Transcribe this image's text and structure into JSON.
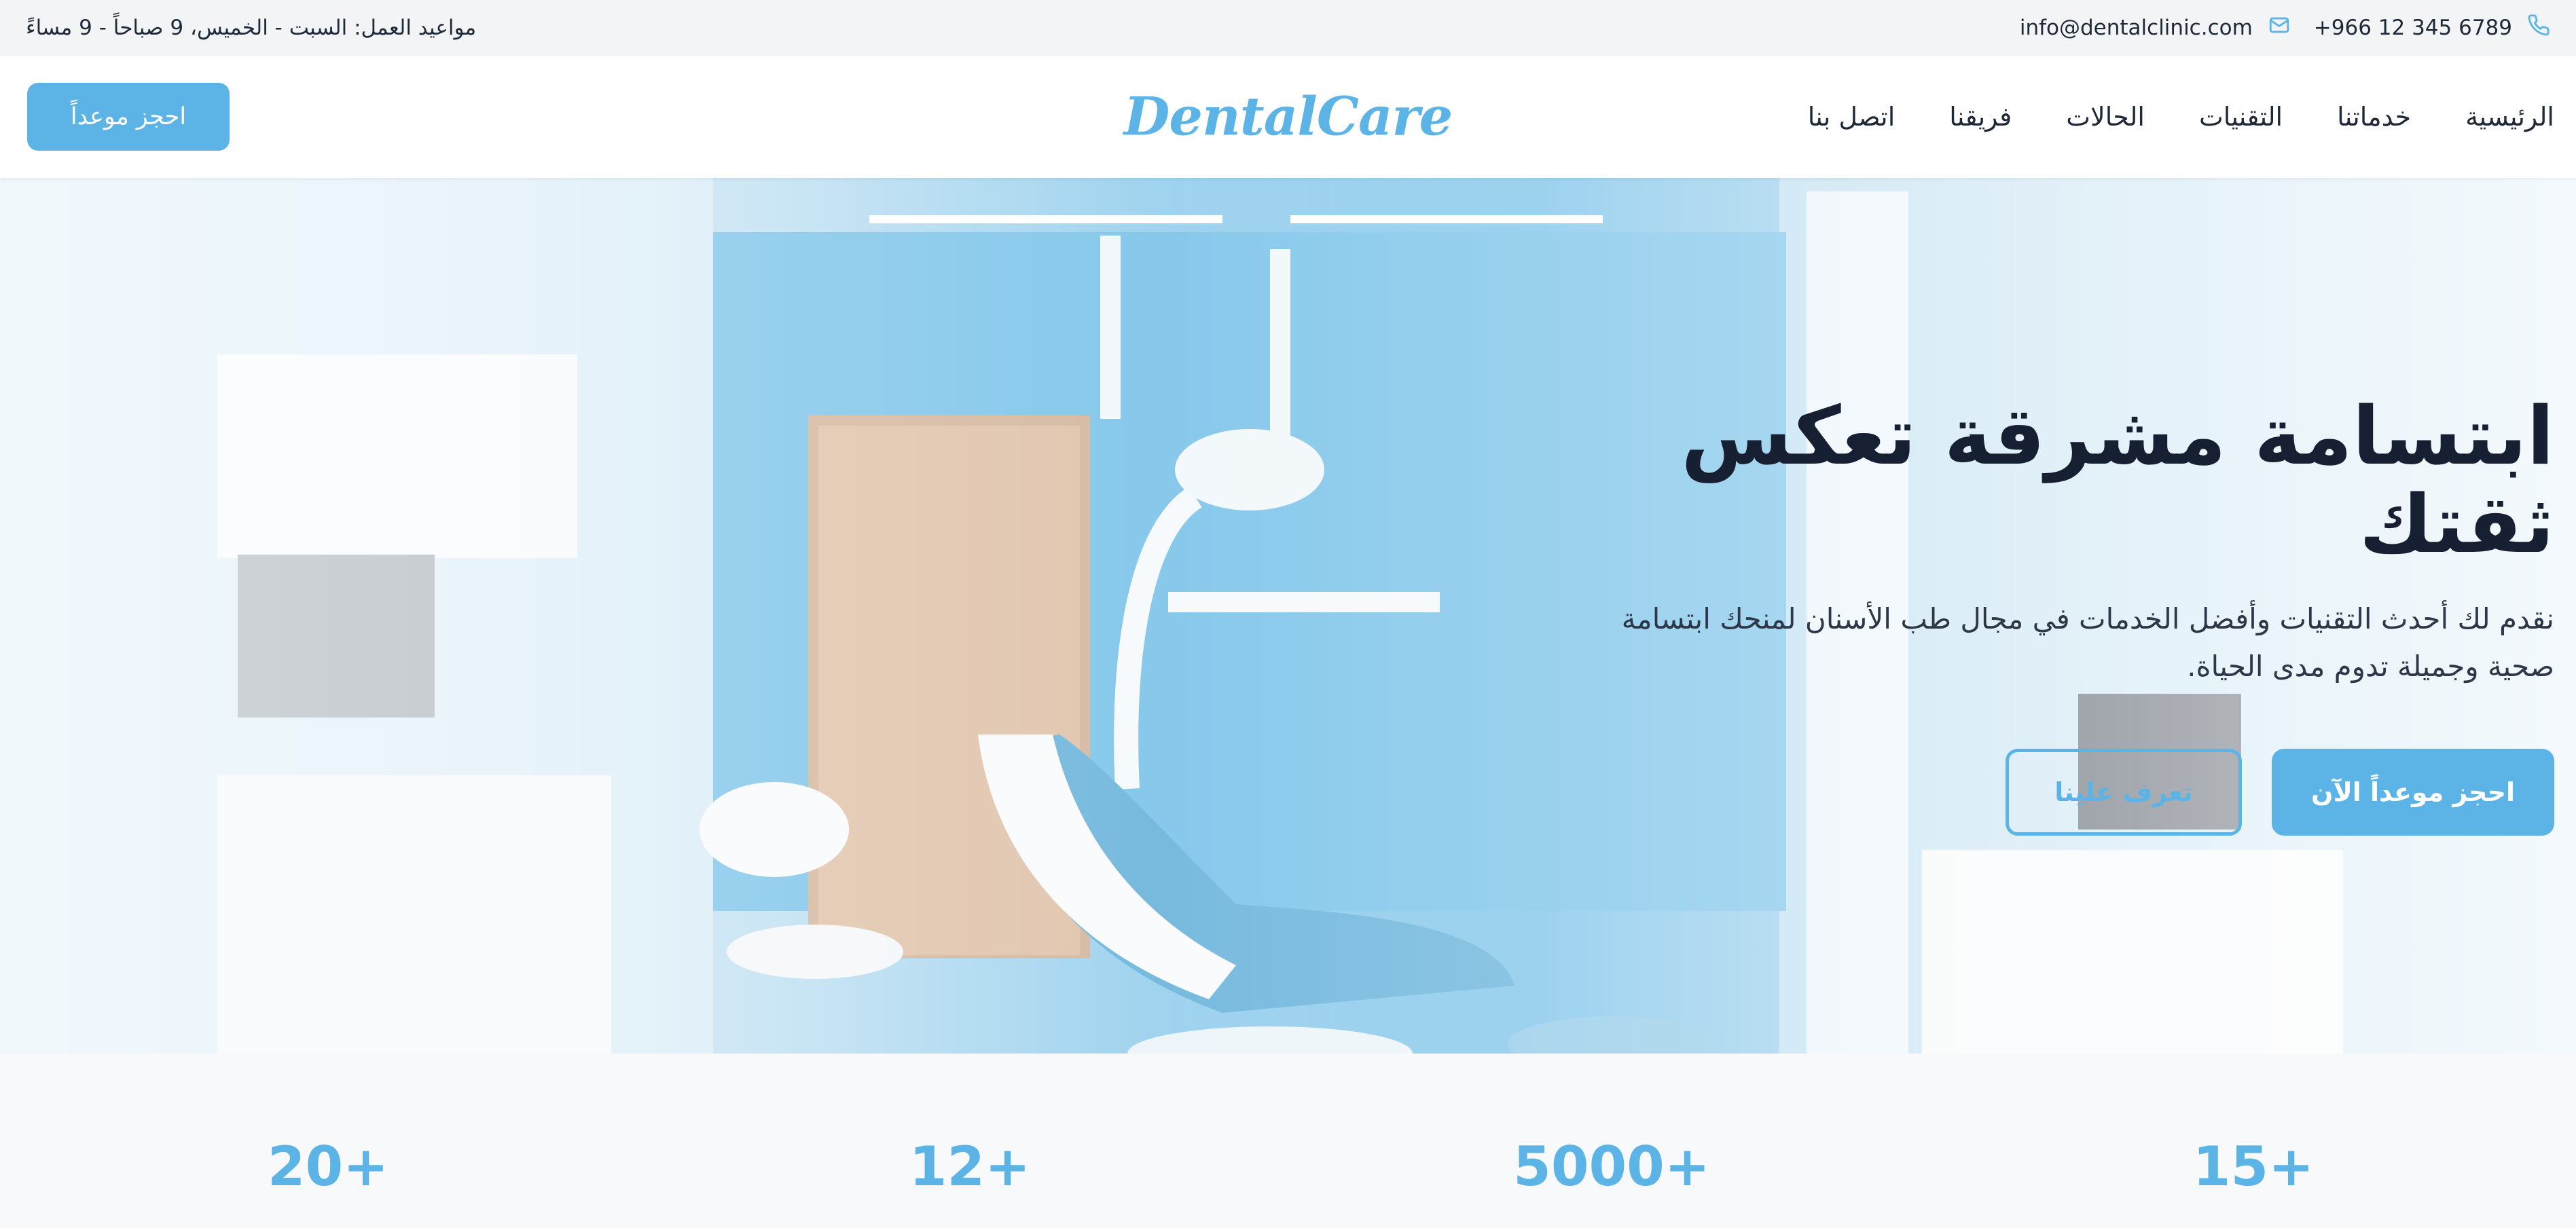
{
  "topbar": {
    "phone": "+966 12 345 6789",
    "email": "info@dentalclinic.com",
    "hours": "مواعيد العمل: السبت - الخميس، 9 صباحاً - 9 مساءً"
  },
  "header": {
    "logo": "DentalCare",
    "nav": [
      "الرئيسية",
      "خدماتنا",
      "التقنيات",
      "الحالات",
      "فريقنا",
      "اتصل بنا"
    ],
    "cta_label": "احجز موعداً"
  },
  "hero": {
    "title": "ابتسامة مشرقة تعكس ثقتك",
    "description": "نقدم لك أحدث التقنيات وأفضل الخدمات في مجال طب الأسنان لمنحك ابتسامة صحية وجميلة تدوم مدى الحياة.",
    "primary_button": "احجز موعداً الآن",
    "secondary_button": "تعرف علينا"
  },
  "stats": [
    "15+",
    "5000+",
    "12+",
    "20+"
  ],
  "colors": {
    "accent": "#5bb4e5",
    "title": "#172033",
    "topbar_bg": "#f3f4f6"
  },
  "icons": [
    "phone-icon",
    "mail-icon"
  ]
}
